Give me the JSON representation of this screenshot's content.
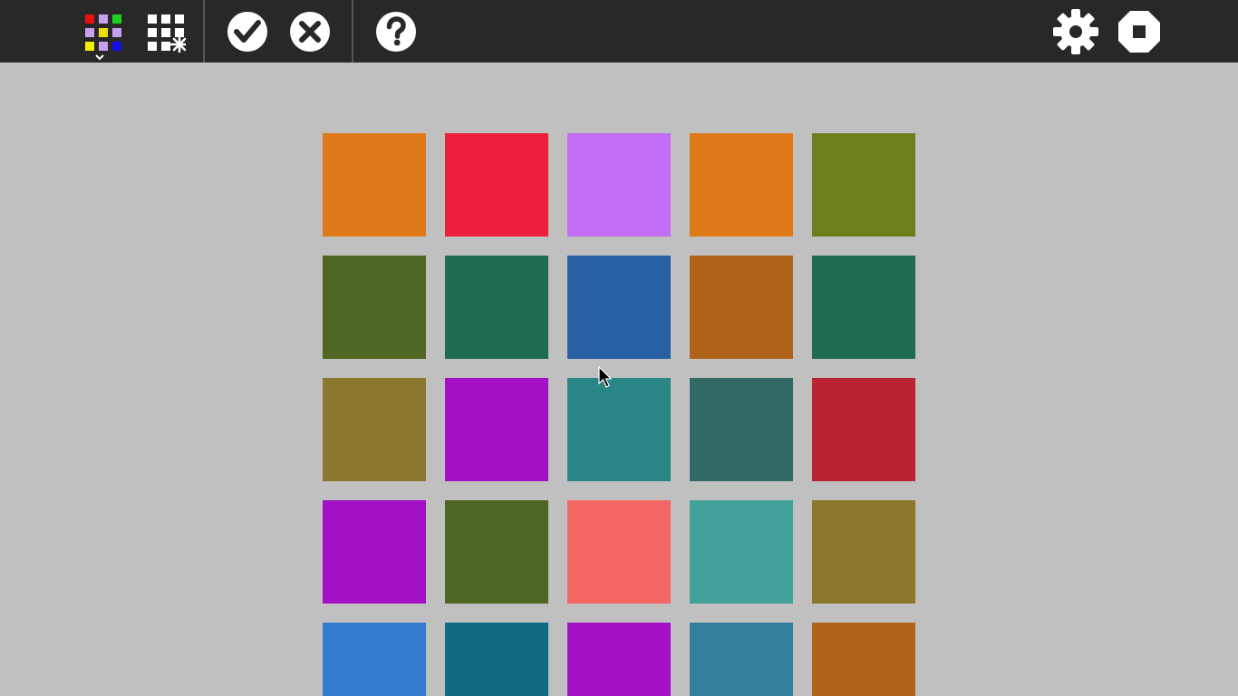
{
  "toolbar": {
    "left_buttons": [
      {
        "name": "palette-select-button",
        "icon": "color-grid-icon"
      },
      {
        "name": "new-game-button",
        "icon": "grid-sparkle-icon"
      },
      {
        "name": "check-button",
        "icon": "check-circle-icon"
      },
      {
        "name": "cancel-button",
        "icon": "close-circle-icon"
      },
      {
        "name": "help-button",
        "icon": "question-circle-icon"
      }
    ],
    "right_buttons": [
      {
        "name": "settings-button",
        "icon": "gear-icon"
      },
      {
        "name": "stop-button",
        "icon": "stop-octagon-icon"
      }
    ],
    "palette_preview_colors": [
      "#e81010",
      "#c8a0f0",
      "#20d020",
      "#c8a0f0",
      "#f0e000",
      "#c8a0f0",
      "#f0f000",
      "#c8a0f0",
      "#1010e0"
    ]
  },
  "board": {
    "rows": 5,
    "cols": 5,
    "tiles": [
      [
        "#de7a18",
        "#ee1f3b",
        "#c36ff5",
        "#de7a18",
        "#6b7f1b"
      ],
      [
        "#506723",
        "#206c50",
        "#2860a4",
        "#b2631a",
        "#206c50"
      ],
      [
        "#8a782c",
        "#a410c6",
        "#298684",
        "#316a64",
        "#ba2332"
      ],
      [
        "#a410c6",
        "#506723",
        "#f56764",
        "#43a19c",
        "#8a782c"
      ],
      [
        "#337ad0",
        "#106a84",
        "#a410c6",
        "#33809e",
        "#b2631a"
      ]
    ]
  }
}
